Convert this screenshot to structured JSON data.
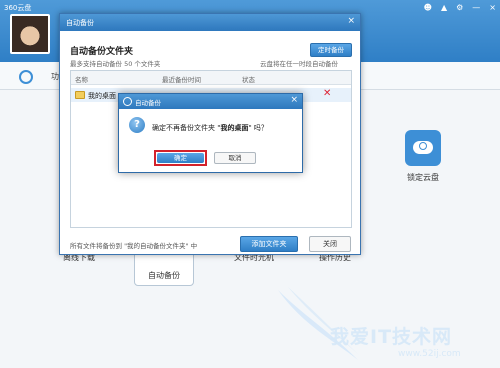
{
  "app": {
    "title": "360云盘",
    "window_controls": [
      "☻",
      "▲",
      "⚙",
      "—",
      "×"
    ],
    "feature_label": "功"
  },
  "tiles": {
    "offline": "离线下载",
    "backup": "自动备份",
    "timemachine": "文件时光机",
    "history": "操作历史",
    "lock": "锁定云盘"
  },
  "backup_dialog": {
    "title": "自动备份",
    "close": "×",
    "heading": "自动备份文件夹",
    "subtitle": "最多支持自动备份 50 个文件夹",
    "schedule_button": "定时备份",
    "hint": "云盘将在任一时段自动备份",
    "columns": {
      "name": "名称",
      "time": "最近备份时间",
      "status": "状态"
    },
    "rows": [
      {
        "name": "我的桌面",
        "remove": "✕"
      }
    ],
    "footer": "所有文件将备份到 \"我的自动备份文件夹\" 中",
    "add_button": "添加文件夹",
    "close_button": "关闭"
  },
  "confirm_dialog": {
    "title": "自动备份",
    "close": "×",
    "icon": "?",
    "msg_prefix": "确定不再备份文件夹 \"",
    "msg_folder": "我的桌面",
    "msg_suffix": "\" 吗？",
    "ok": "确定",
    "cancel": "取消"
  },
  "watermark": {
    "text": "我爱IT技术网",
    "url": "www.52ij.com"
  }
}
